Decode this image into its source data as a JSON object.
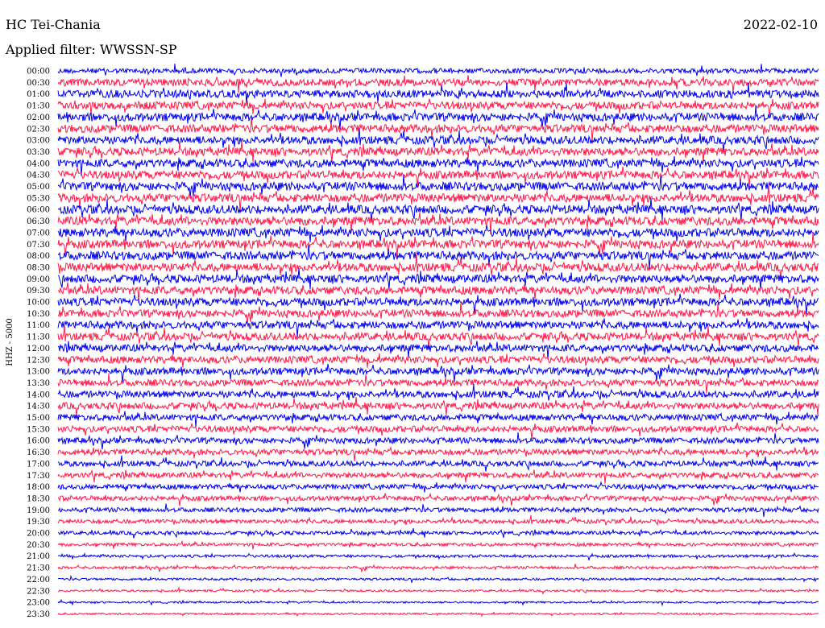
{
  "header": {
    "station": "HC Tei-Chania",
    "date": "2022-02-10",
    "filter": "Applied filter: WWSSN-SP"
  },
  "chart_data": {
    "type": "line",
    "title": "HC Tei-Chania",
    "subtitle": "Applied filter: WWSSN-SP",
    "ylabel": "HHZ - 5000",
    "date": "2022-02-10",
    "row_labels": [
      "00:00",
      "00:30",
      "01:00",
      "01:30",
      "02:00",
      "02:30",
      "03:00",
      "03:30",
      "04:00",
      "04:30",
      "05:00",
      "05:30",
      "06:00",
      "06:30",
      "07:00",
      "07:30",
      "08:00",
      "08:30",
      "09:00",
      "09:30",
      "10:00",
      "10:30",
      "11:00",
      "11:30",
      "12:00",
      "12:30",
      "13:00",
      "13:30",
      "14:00",
      "14:30",
      "15:00",
      "15:30",
      "16:00",
      "16:30",
      "17:00",
      "17:30",
      "18:00",
      "18:30",
      "19:00",
      "19:30",
      "20:00",
      "20:30",
      "21:00",
      "21:30",
      "22:00",
      "22:30",
      "23:00",
      "23:30"
    ],
    "row_colors": [
      "#0000ee",
      "#ff1a4a"
    ],
    "row_amplitude": [
      0.55,
      0.8,
      0.85,
      0.85,
      0.9,
      0.9,
      0.9,
      0.9,
      0.9,
      0.9,
      0.95,
      0.95,
      0.95,
      0.95,
      0.95,
      0.95,
      0.95,
      0.95,
      0.9,
      0.9,
      0.9,
      0.85,
      0.85,
      0.85,
      0.8,
      0.8,
      0.8,
      0.75,
      0.75,
      0.75,
      0.7,
      0.7,
      0.65,
      0.65,
      0.6,
      0.6,
      0.55,
      0.55,
      0.5,
      0.45,
      0.4,
      0.35,
      0.3,
      0.3,
      0.25,
      0.22,
      0.2,
      0.2
    ],
    "grid": false,
    "legend": "none"
  }
}
